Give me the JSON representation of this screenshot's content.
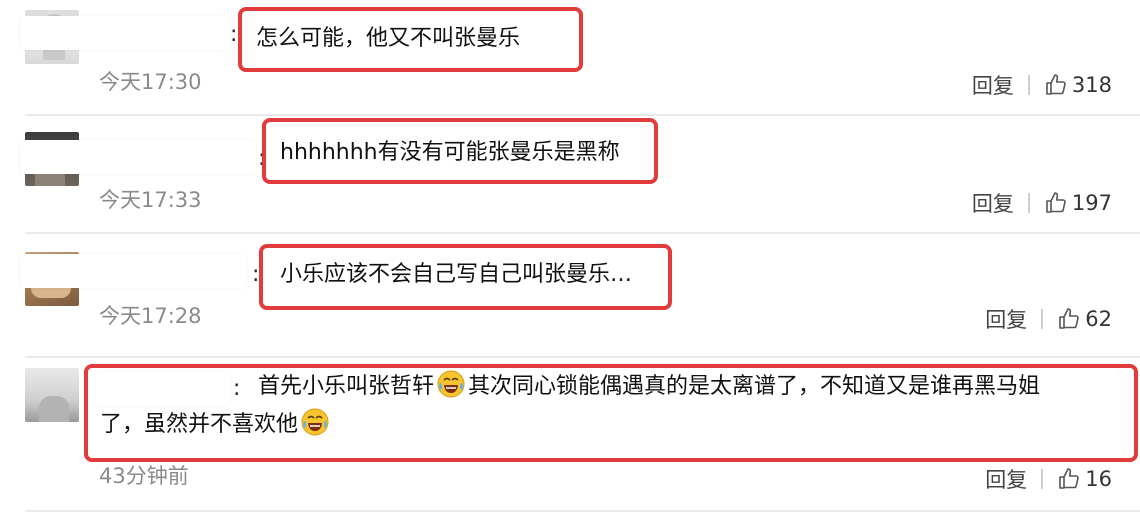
{
  "comments": [
    {
      "text": "怎么可能，他又不叫张曼乐",
      "time": "今天17:30",
      "reply_label": "回复",
      "like_count": "318"
    },
    {
      "text": "hhhhhhh有没有可能张曼乐是黑称",
      "time": "今天17:33",
      "reply_label": "回复",
      "like_count": "197"
    },
    {
      "text": "小乐应该不会自己写自己叫张曼乐…",
      "time": "今天17:28",
      "reply_label": "回复",
      "like_count": "62"
    },
    {
      "text_part1": "首先小乐叫张哲轩",
      "text_part2": "其次同心锁能偶遇真的是太离谱了，不知道又是谁再黑马姐",
      "text_part3": "了，虽然并不喜欢他",
      "emoji": "laugh-cry-emoji",
      "time": "43分钟前",
      "reply_label": "回复",
      "like_count": "16"
    }
  ],
  "colors": {
    "highlight": "#e23b3b",
    "time": "#8a8a8a",
    "divider": "#e9e9e9"
  }
}
